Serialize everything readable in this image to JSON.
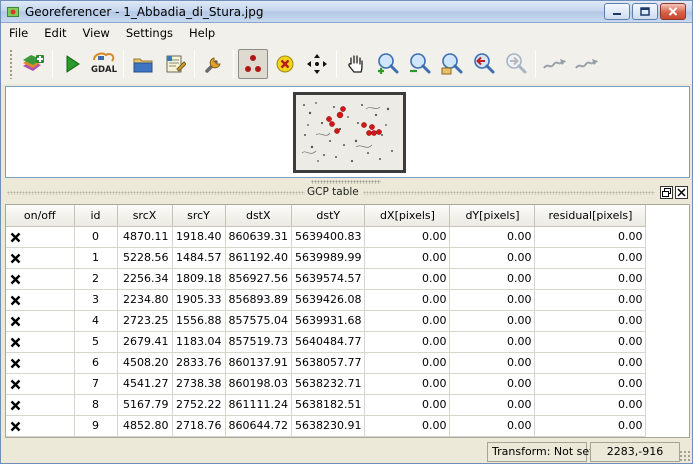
{
  "window": {
    "title": "Georeferencer - 1_Abbadia_di_Stura.jpg"
  },
  "menu": [
    "File",
    "Edit",
    "View",
    "Settings",
    "Help"
  ],
  "toolbar": {
    "icons": [
      "open-raster-icon",
      "start-georeferencing-icon",
      "generate-gdal-script-icon",
      "load-gcp-points-icon",
      "save-gcp-points-icon",
      "transformation-settings-icon",
      "add-point-icon",
      "delete-point-icon",
      "move-gcp-point-icon",
      "pan-icon",
      "zoom-in-icon",
      "zoom-out-icon",
      "zoom-to-layer-icon",
      "zoom-last-icon",
      "zoom-next-icon",
      "link-georeferencer-to-qgis-icon",
      "link-qgis-to-georeferencer-icon"
    ],
    "gdal_label": "GDAL"
  },
  "dock": {
    "title": "GCP table"
  },
  "gcp_table": {
    "columns": [
      "on/off",
      "id",
      "srcX",
      "srcY",
      "dstX",
      "dstY",
      "dX[pixels]",
      "dY[pixels]",
      "residual[pixels]"
    ],
    "rows": [
      {
        "id": "0",
        "srcX": "4870.11",
        "srcY": "1918.40",
        "dstX": "860639.31",
        "dstY": "5639400.83",
        "dX": "0.00",
        "dY": "0.00",
        "residual": "0.00"
      },
      {
        "id": "1",
        "srcX": "5228.56",
        "srcY": "1484.57",
        "dstX": "861192.40",
        "dstY": "5639989.99",
        "dX": "0.00",
        "dY": "0.00",
        "residual": "0.00"
      },
      {
        "id": "2",
        "srcX": "2256.34",
        "srcY": "1809.18",
        "dstX": "856927.56",
        "dstY": "5639574.57",
        "dX": "0.00",
        "dY": "0.00",
        "residual": "0.00"
      },
      {
        "id": "3",
        "srcX": "2234.80",
        "srcY": "1905.33",
        "dstX": "856893.89",
        "dstY": "5639426.08",
        "dX": "0.00",
        "dY": "0.00",
        "residual": "0.00"
      },
      {
        "id": "4",
        "srcX": "2723.25",
        "srcY": "1556.88",
        "dstX": "857575.04",
        "dstY": "5639931.68",
        "dX": "0.00",
        "dY": "0.00",
        "residual": "0.00"
      },
      {
        "id": "5",
        "srcX": "2679.41",
        "srcY": "1183.04",
        "dstX": "857519.73",
        "dstY": "5640484.77",
        "dX": "0.00",
        "dY": "0.00",
        "residual": "0.00"
      },
      {
        "id": "6",
        "srcX": "4508.20",
        "srcY": "2833.76",
        "dstX": "860137.91",
        "dstY": "5638057.77",
        "dX": "0.00",
        "dY": "0.00",
        "residual": "0.00"
      },
      {
        "id": "7",
        "srcX": "4541.27",
        "srcY": "2738.38",
        "dstX": "860198.03",
        "dstY": "5638232.71",
        "dX": "0.00",
        "dY": "0.00",
        "residual": "0.00"
      },
      {
        "id": "8",
        "srcX": "5167.79",
        "srcY": "2752.22",
        "dstX": "861111.24",
        "dstY": "5638182.51",
        "dX": "0.00",
        "dY": "0.00",
        "residual": "0.00"
      },
      {
        "id": "9",
        "srcX": "4852.80",
        "srcY": "2718.76",
        "dstX": "860644.72",
        "dstY": "5638230.91",
        "dX": "0.00",
        "dY": "0.00",
        "residual": "0.00"
      }
    ]
  },
  "status": {
    "transform": "Transform: Not set",
    "coords": "2283,-916"
  },
  "colors": {
    "gcp_point": "#d01818",
    "accent_border": "#7a9cc7"
  }
}
